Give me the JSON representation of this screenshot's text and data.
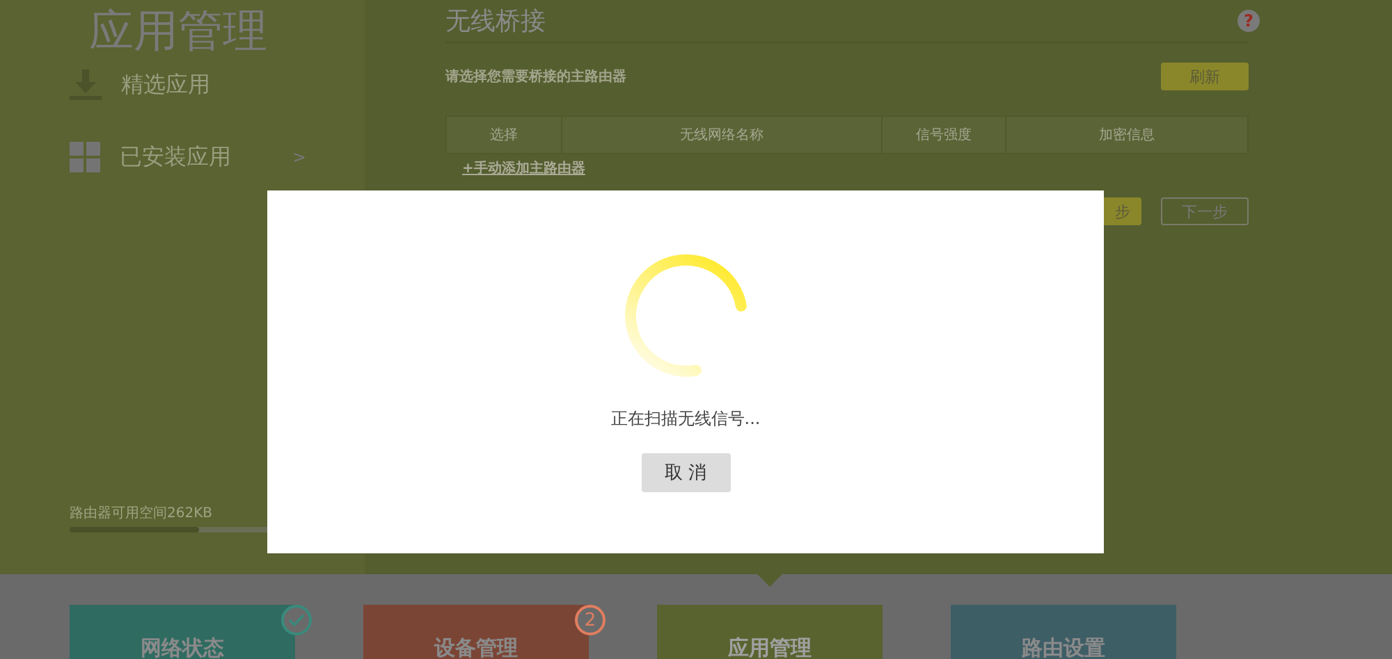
{
  "sidebar": {
    "title": "应用管理",
    "items": [
      {
        "kind": "download",
        "label": "精选应用"
      },
      {
        "kind": "grid",
        "label": "已安装应用",
        "arrow": ">"
      }
    ],
    "storage": {
      "label": "路由器可用空间262KB",
      "level": 0.62
    }
  },
  "main": {
    "title": "无线桥接",
    "help": "?",
    "prompt": "请选择您需要桥接的主路由器",
    "refresh_button": "刷新",
    "table": {
      "columns": [
        "选择",
        "无线网络名称",
        "信号强度",
        "加密信息"
      ]
    },
    "add_link": "+手动添加主路由器",
    "buttons": [
      {
        "label": "步",
        "kind": "primary"
      },
      {
        "label": "下一步",
        "kind": "outline"
      }
    ]
  },
  "dialog": {
    "message": "正在扫描无线信号...",
    "cancel_button": "取 消"
  },
  "nav_tiles": [
    {
      "kind": "check",
      "label": "网络状态",
      "color": "#2f6b61",
      "selected": false
    },
    {
      "kind": "count",
      "label": "设备管理",
      "color": "#7b4535",
      "badge": "2",
      "selected": false
    },
    {
      "kind": "plain",
      "label": "应用管理",
      "color": "#59632f",
      "selected": true
    },
    {
      "kind": "plain",
      "label": "路由设置",
      "color": "#3e5e66",
      "selected": false
    }
  ]
}
